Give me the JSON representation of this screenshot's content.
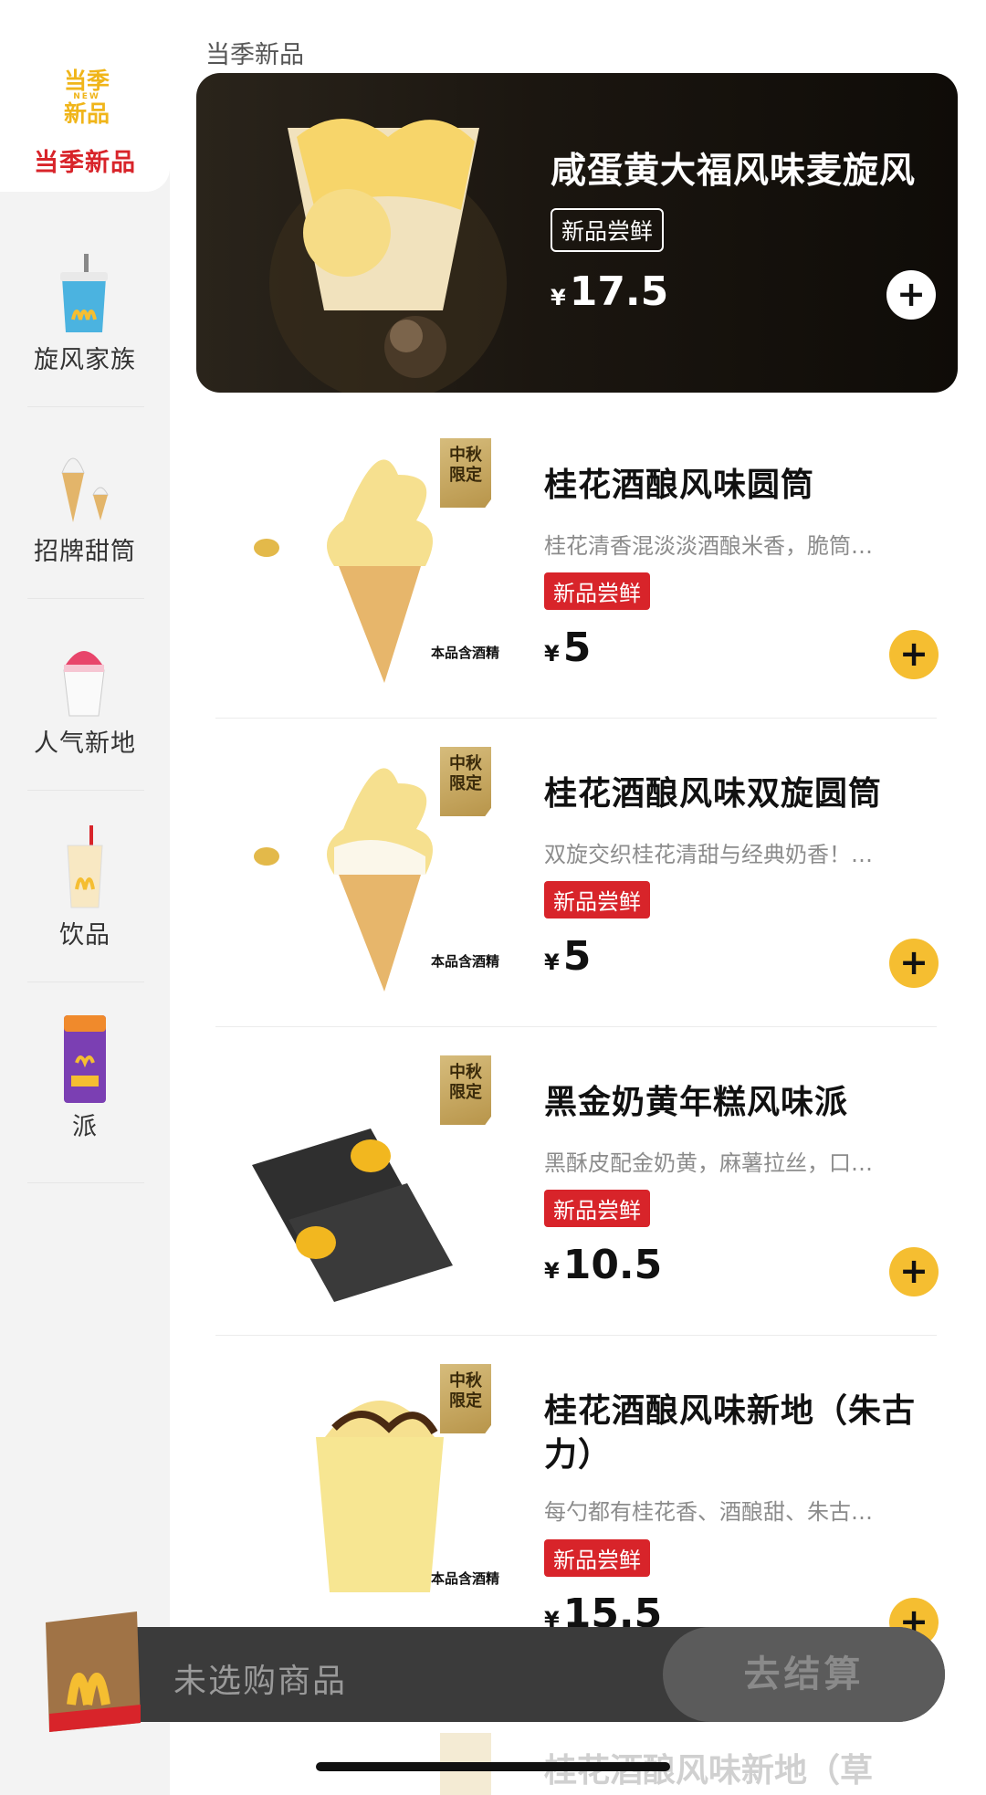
{
  "section_title": "当季新品",
  "sidebar": {
    "badge": {
      "line1": "当季",
      "line2": "NEW",
      "line3": "新品"
    },
    "items": [
      {
        "label": "当季新品"
      },
      {
        "label": "旋风家族"
      },
      {
        "label": "招牌甜筒"
      },
      {
        "label": "人气新地"
      },
      {
        "label": "饮品"
      },
      {
        "label": "派"
      }
    ]
  },
  "featured": {
    "name": "咸蛋黄大福风味麦旋风",
    "tag": "新品尝鲜",
    "currency": "¥",
    "price": "17.5",
    "add": "+"
  },
  "products": [
    {
      "name": "桂花酒酿风味圆筒",
      "desc": "桂花清香混淡淡酒酿米香，脆筒…",
      "tag": "新品尝鲜",
      "currency": "¥",
      "price": "5",
      "limited": "中秋限定",
      "alcohol": "本品含酒精",
      "add": "+"
    },
    {
      "name": "桂花酒酿风味双旋圆筒",
      "desc": "双旋交织桂花清甜与经典奶香！…",
      "tag": "新品尝鲜",
      "currency": "¥",
      "price": "5",
      "limited": "中秋限定",
      "alcohol": "本品含酒精",
      "add": "+"
    },
    {
      "name": "黑金奶黄年糕风味派",
      "desc": "黑酥皮配金奶黄，麻薯拉丝，口…",
      "tag": "新品尝鲜",
      "currency": "¥",
      "price": "10.5",
      "limited": "中秋限定",
      "add": "+"
    },
    {
      "name": "桂花酒酿风味新地（朱古力）",
      "desc": "每勺都有桂花香、酒酿甜、朱古…",
      "tag": "新品尝鲜",
      "currency": "¥",
      "price": "15.5",
      "limited": "中秋限定",
      "alcohol": "本品含酒精",
      "add": "+"
    }
  ],
  "peek_item": "桂花酒酿风味新地（草",
  "cart": {
    "empty_text": "未选购商品",
    "checkout": "去结算"
  },
  "colors": {
    "brand_red": "#d8242a",
    "brand_yellow": "#f5be31",
    "cart_bg": "#3b3b3b"
  }
}
